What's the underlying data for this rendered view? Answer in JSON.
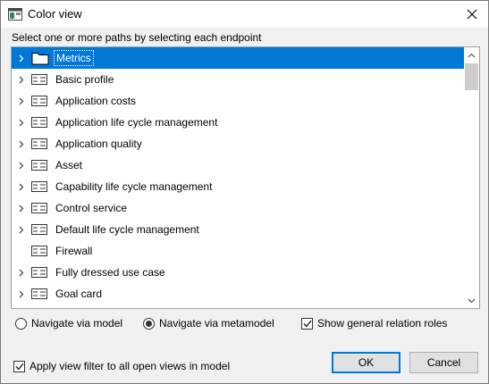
{
  "window": {
    "title": "Color view"
  },
  "instruction": "Select one or more paths by selecting each endpoint",
  "tree": {
    "items": [
      {
        "label": "Metrics",
        "icon": "folder-icon",
        "expandable": true,
        "selected": true
      },
      {
        "label": "Basic profile",
        "icon": "list-icon",
        "expandable": true,
        "selected": false
      },
      {
        "label": "Application costs",
        "icon": "list-icon",
        "expandable": true,
        "selected": false
      },
      {
        "label": "Application life cycle management",
        "icon": "list-icon",
        "expandable": true,
        "selected": false
      },
      {
        "label": "Application quality",
        "icon": "list-icon",
        "expandable": true,
        "selected": false
      },
      {
        "label": "Asset",
        "icon": "list-icon",
        "expandable": true,
        "selected": false
      },
      {
        "label": "Capability life cycle management",
        "icon": "list-icon",
        "expandable": true,
        "selected": false
      },
      {
        "label": "Control service",
        "icon": "list-icon",
        "expandable": true,
        "selected": false
      },
      {
        "label": "Default life cycle management",
        "icon": "list-icon",
        "expandable": true,
        "selected": false
      },
      {
        "label": "Firewall",
        "icon": "list-icon",
        "expandable": false,
        "selected": false
      },
      {
        "label": "Fully dressed use case",
        "icon": "list-icon",
        "expandable": true,
        "selected": false
      },
      {
        "label": "Goal card",
        "icon": "list-icon",
        "expandable": true,
        "selected": false
      }
    ]
  },
  "options": {
    "navigate_model": {
      "label": "Navigate via model",
      "checked": false
    },
    "navigate_metamodel": {
      "label": "Navigate via metamodel",
      "checked": true
    },
    "show_general_roles": {
      "label": "Show general relation roles",
      "checked": true
    },
    "apply_filter": {
      "label": "Apply view filter to all open views in model",
      "checked": true
    }
  },
  "buttons": {
    "ok": "OK",
    "cancel": "Cancel"
  },
  "colors": {
    "selection": "#0078d7",
    "dialog_bg": "#f0f0f0"
  }
}
